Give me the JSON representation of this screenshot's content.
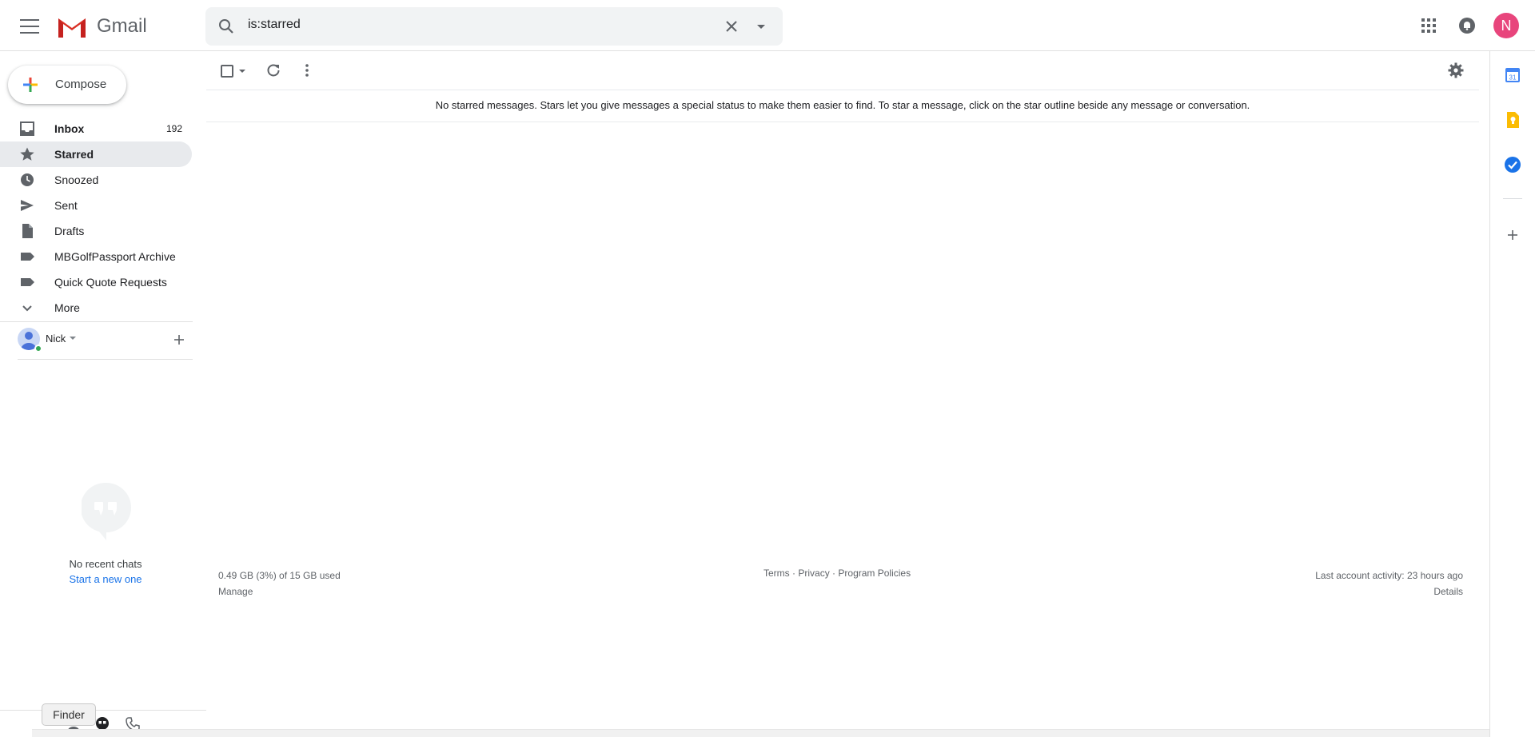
{
  "header": {
    "app_name": "Gmail",
    "search_value": "is:starred",
    "avatar_letter": "N",
    "icons": [
      "menu-icon",
      "gmail-logo",
      "search-icon",
      "clear-icon",
      "dropdown-icon",
      "apps-icon",
      "notifications-icon"
    ]
  },
  "sidebar": {
    "compose_label": "Compose",
    "items": [
      {
        "label": "Inbox",
        "count": "192",
        "icon": "inbox-icon",
        "bold": true
      },
      {
        "label": "Starred",
        "count": "",
        "icon": "star-icon",
        "active": true
      },
      {
        "label": "Snoozed",
        "count": "",
        "icon": "clock-icon"
      },
      {
        "label": "Sent",
        "count": "",
        "icon": "send-icon"
      },
      {
        "label": "Drafts",
        "count": "",
        "icon": "draft-icon"
      },
      {
        "label": "MBGolfPassport Archive",
        "count": "",
        "icon": "label-icon"
      },
      {
        "label": "Quick Quote Requests",
        "count": "",
        "icon": "label-icon"
      },
      {
        "label": "More",
        "count": "",
        "icon": "chevron-down-icon"
      }
    ],
    "hangouts": {
      "user_name": "Nick",
      "no_chats": "No recent chats",
      "start_new": "Start a new one"
    },
    "finder_tooltip": "Finder"
  },
  "main": {
    "empty_message": "No starred messages. Stars let you give messages a special status to make them easier to find. To star a message, click on the star outline beside any message or conversation.",
    "footer": {
      "storage": "0.49 GB (3%) of 15 GB used",
      "manage": "Manage",
      "terms": "Terms",
      "privacy": "Privacy",
      "program_policies": "Program Policies",
      "sep": "·",
      "last_activity": "Last account activity: 23 hours ago",
      "details": "Details"
    }
  },
  "colors": {
    "accent": "#1a73e8",
    "active_bg": "#e8eaed",
    "avatar": "#e8457c",
    "status_online": "#34a853"
  }
}
